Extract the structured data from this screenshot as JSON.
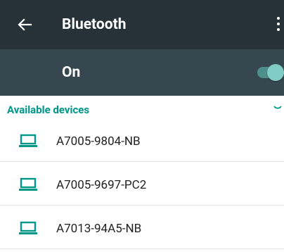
{
  "appbar": {
    "title": "Bluetooth",
    "back_icon": "arrow-back-icon",
    "overflow_icon": "more-vert-icon"
  },
  "switch_row": {
    "label": "On",
    "toggle_state": true
  },
  "devices_section": {
    "header": "Available devices",
    "devices": [
      {
        "name": "A7005-9804-NB",
        "icon": "laptop-icon"
      },
      {
        "name": "A7005-9697-PC2",
        "icon": "laptop-icon"
      },
      {
        "name": "A7013-94A5-NB",
        "icon": "laptop-icon"
      }
    ]
  },
  "colors": {
    "appbar": "#263238",
    "switchbar": "#37474f",
    "accent": "#009688",
    "toggle_thumb": "#80cbc4"
  }
}
